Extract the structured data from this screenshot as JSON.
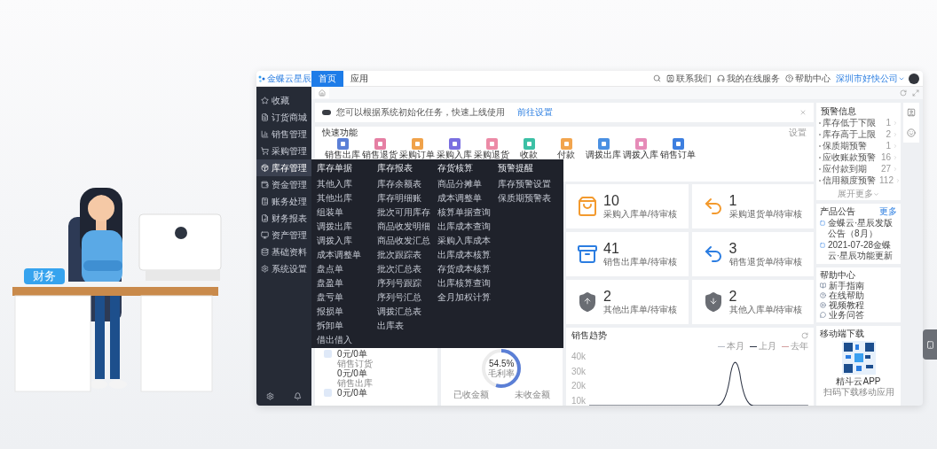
{
  "illustration": {
    "tag": "财务"
  },
  "topbar": {
    "logo": "金蝶云星辰",
    "tabs": [
      {
        "label": "首页",
        "selected": true
      },
      {
        "label": "应用",
        "selected": false
      }
    ],
    "links": [
      "联系我们",
      "我的在线服务",
      "帮助中心"
    ],
    "company": "深圳市好快公司"
  },
  "sidebar": {
    "items": [
      {
        "label": "收藏",
        "selected": false
      },
      {
        "label": "订货商城",
        "selected": false
      },
      {
        "label": "销售管理",
        "selected": false
      },
      {
        "label": "采购管理",
        "selected": false
      },
      {
        "label": "库存管理",
        "selected": true
      },
      {
        "label": "资金管理",
        "selected": false
      },
      {
        "label": "账务处理",
        "selected": false
      },
      {
        "label": "财务报表",
        "selected": false
      },
      {
        "label": "资产管理",
        "selected": false
      },
      {
        "label": "基础资料",
        "selected": false
      },
      {
        "label": "系统设置",
        "selected": false
      }
    ]
  },
  "notice": {
    "text": "您可以根据系统初始化任务，快速上线使用",
    "link": "前往设置"
  },
  "quick": {
    "title": "快速功能",
    "action": "设置",
    "items": [
      {
        "label": "销售出库",
        "color": "#5b7fd6"
      },
      {
        "label": "销售退货",
        "color": "#e57fa3"
      },
      {
        "label": "采购订单",
        "color": "#f0a24a"
      },
      {
        "label": "采购入库",
        "color": "#7a6fe0"
      },
      {
        "label": "采购退货",
        "color": "#ec8aa6"
      },
      {
        "label": "收款",
        "color": "#3cc0a5"
      },
      {
        "label": "付款",
        "color": "#f2a54e"
      },
      {
        "label": "调拨出库",
        "color": "#4a90e2"
      },
      {
        "label": "调拨入库",
        "color": "#e68bb8"
      },
      {
        "label": "销售订单",
        "color": "#3d7fe0"
      }
    ]
  },
  "menu": {
    "columns": [
      {
        "heading": "库存单据",
        "items": [
          "其他入库",
          "其他出库",
          "组装单",
          "调拨出库",
          "调拨入库",
          "成本调整单",
          "盘点单",
          "盘盈单",
          "盘亏单",
          "报损单",
          "拆卸单",
          "借出借入"
        ]
      },
      {
        "heading": "库存报表",
        "items": [
          "库存余额表",
          "库存明细账",
          "批次可用库存",
          "商品收发明细",
          "商品收发汇总",
          "批次跟踪表",
          "批次汇总表",
          "序列号跟踪",
          "序列号汇总",
          "调拨汇总表",
          "出库表"
        ]
      },
      {
        "heading": "存货核算",
        "items": [
          "商品分摊单",
          "成本调整单",
          "核算单据查询",
          "出库成本查询",
          "采购入库成本",
          "出库成本核算",
          "存货成本核算",
          "出库核算查询",
          "全月加权计算"
        ]
      },
      {
        "heading": "预警提醒",
        "items": [
          "库存预警设置",
          "保质期预警表"
        ]
      }
    ]
  },
  "stats": [
    {
      "value": "10",
      "label": "采购入库单/待审核",
      "kind": "bag",
      "color": "#f39a2e"
    },
    {
      "value": "1",
      "label": "采购退货单/待审核",
      "kind": "return",
      "color": "#f39a2e"
    },
    {
      "value": "41",
      "label": "销售出库单/待审核",
      "kind": "box",
      "color": "#2b7de1"
    },
    {
      "value": "3",
      "label": "销售退货单/待审核",
      "kind": "return",
      "color": "#2b7de1"
    },
    {
      "value": "2",
      "label": "其他出库单/待审核",
      "kind": "shield-up",
      "color": "#6a6d73"
    },
    {
      "value": "2",
      "label": "其他入库单/待审核",
      "kind": "shield-down",
      "color": "#6a6d73"
    }
  ],
  "timeline": [
    {
      "lines": [
        "0元/0单",
        "销售订货",
        "0元/0单",
        "销售出库"
      ]
    },
    {
      "lines": [
        "0元/0单"
      ]
    }
  ],
  "margin": {
    "reading": "54.5%",
    "caption": "毛利率",
    "level": 0.545,
    "footer": [
      "已收金额",
      "未收金额"
    ]
  },
  "trend": {
    "title": "销售趋势",
    "legend": [
      {
        "label": "本月",
        "color": "#b8bcc6"
      },
      {
        "label": "上月",
        "color": "#2f3646"
      },
      {
        "label": "去年",
        "color": "#d3a0a0"
      }
    ],
    "axis_labels": [
      "40k",
      "30k",
      "20k",
      "10k"
    ]
  },
  "warnings": {
    "title": "预警信息",
    "items": [
      {
        "label": "库存低于下限",
        "count": "1"
      },
      {
        "label": "库存高于上限",
        "count": "2"
      },
      {
        "label": "保质期预警",
        "count": "1"
      },
      {
        "label": "应收账款预警",
        "count": "16"
      },
      {
        "label": "应付款到期",
        "count": "27"
      },
      {
        "label": "信用额度预警",
        "count": "112"
      }
    ],
    "more": "展开更多"
  },
  "announcements": {
    "title": "产品公告",
    "more": "更多",
    "items": [
      "金蝶云·星辰发版公告（8月）",
      "2021-07-28金蝶云·星辰功能更新"
    ]
  },
  "help": {
    "title": "帮助中心",
    "items": [
      "新手指南",
      "在线帮助",
      "视频教程",
      "业务问答"
    ]
  },
  "download": {
    "title": "移动端下载",
    "app": "精斗云APP",
    "hint": "扫码下载移动应用"
  }
}
